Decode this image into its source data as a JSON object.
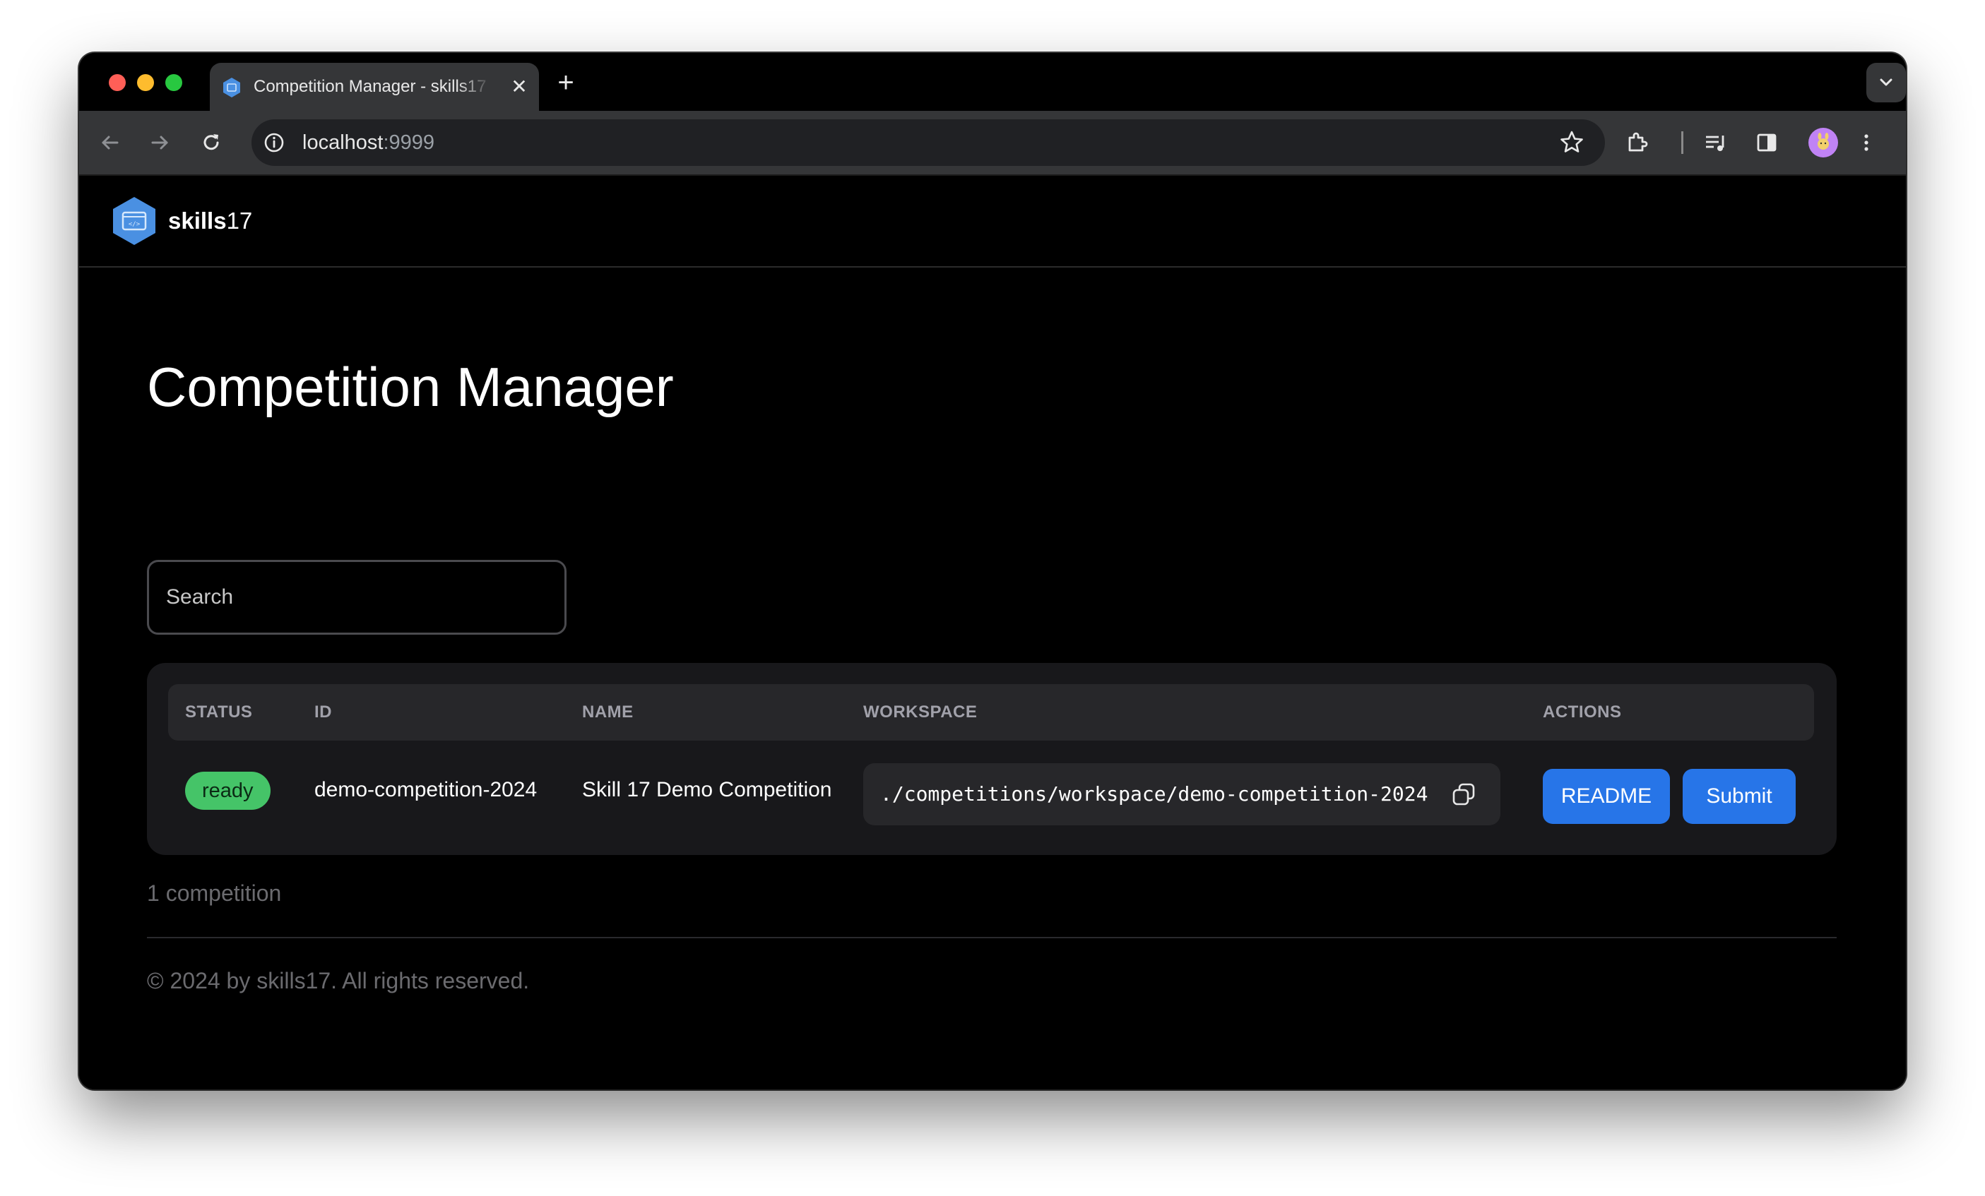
{
  "browser": {
    "tab_title": "Competition Manager - skills17",
    "url_host": "localhost",
    "url_port": ":9999",
    "new_tab_glyph": "+",
    "close_glyph": "✕"
  },
  "app": {
    "brand_bold": "skills",
    "brand_num": "17",
    "page_title": "Competition Manager",
    "search_placeholder": "Search"
  },
  "table": {
    "headers": {
      "status": "STATUS",
      "id": "ID",
      "name": "NAME",
      "workspace": "WORKSPACE",
      "actions": "ACTIONS"
    },
    "rows": [
      {
        "status": "ready",
        "id": "demo-competition-2024",
        "name": "Skill 17 Demo Competition",
        "workspace": "./competitions/workspace/demo-competition-2024",
        "readme_label": "README",
        "submit_label": "Submit"
      }
    ]
  },
  "summary": {
    "count_text": "1 competition"
  },
  "footer": {
    "text": "© 2024 by skills17. All rights reserved."
  },
  "colors": {
    "accent_button": "#2775e8",
    "status_ready": "#45c468",
    "logo_blue": "#4a90e2"
  },
  "icons": {
    "back": "arrow-left-icon",
    "forward": "arrow-right-icon",
    "reload": "reload-icon",
    "site_info": "info-icon",
    "bookmark": "star-icon",
    "extensions": "puzzle-icon",
    "media": "media-queue-icon",
    "side_panel": "side-panel-icon",
    "menu": "kebab-menu-icon",
    "copy": "copy-icon"
  }
}
